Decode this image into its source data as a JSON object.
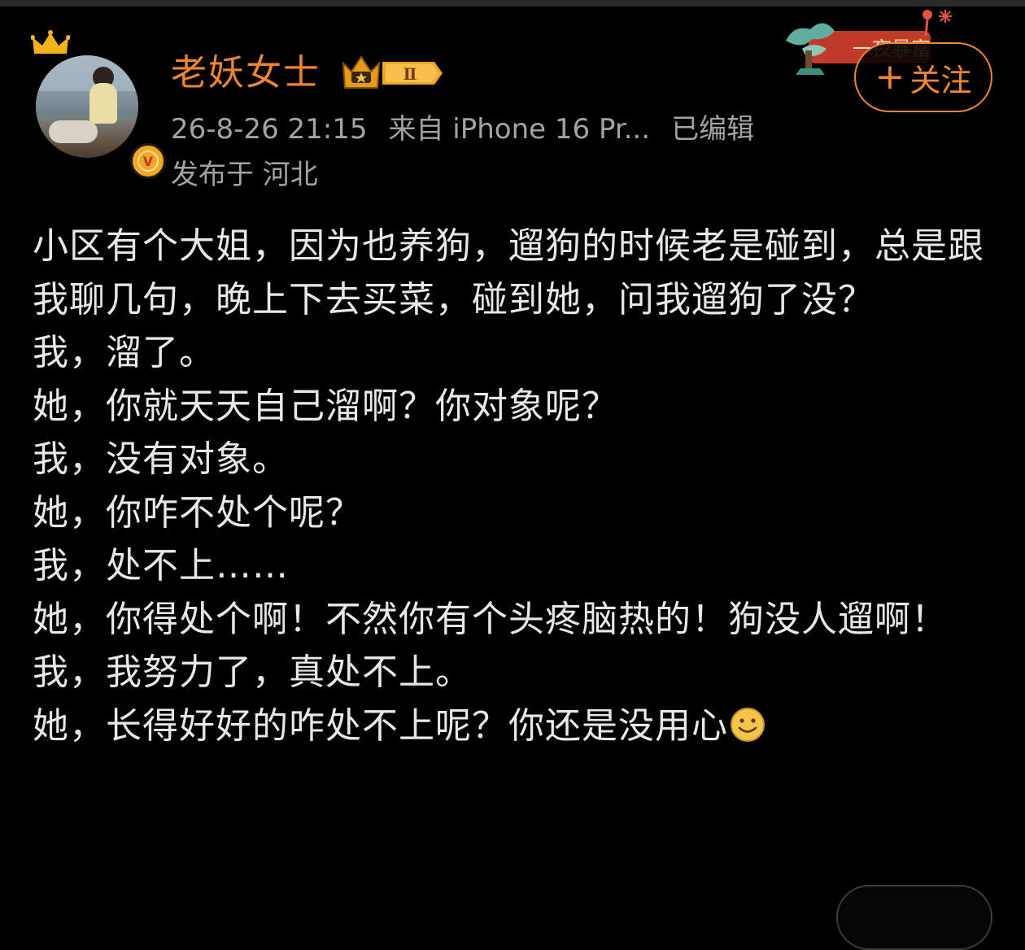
{
  "user": {
    "name": "老妖女士",
    "level_badge": "Ⅱ",
    "verified_mark": "V"
  },
  "meta": {
    "timestamp": "26-8-26 21:15",
    "source": "来自 iPhone 16 Pr...",
    "edited": "已编辑",
    "location": "发布于 河北"
  },
  "actions": {
    "follow_plus": "+",
    "follow_label": "关注"
  },
  "decoration_text": "一夜暴富",
  "post": {
    "lines": [
      "小区有个大姐，因为也养狗，遛狗的时候老是碰到，总是跟我聊几句，晚上下去买菜，碰到她，问我遛狗了没？",
      "我，溜了。",
      "她，你就天天自己溜啊？你对象呢？",
      "我，没有对象。",
      "她，你咋不处个呢？",
      "我，处不上……",
      "她，你得处个啊！不然你有个头疼脑热的！狗没人遛啊！",
      "我，我努力了，真处不上。",
      "她，长得好好的咋处不上呢？你还是没用心"
    ],
    "emoji": "smiley-emoji"
  },
  "colors": {
    "accent": "#f0862c",
    "meta_text": "#a3a3a3",
    "body_text": "#e8e8e8",
    "background": "#000000"
  },
  "icons": [
    "crown-icon",
    "verified-badge-icon",
    "level-crown-badge-icon",
    "plus-icon",
    "smiley-emoji"
  ]
}
